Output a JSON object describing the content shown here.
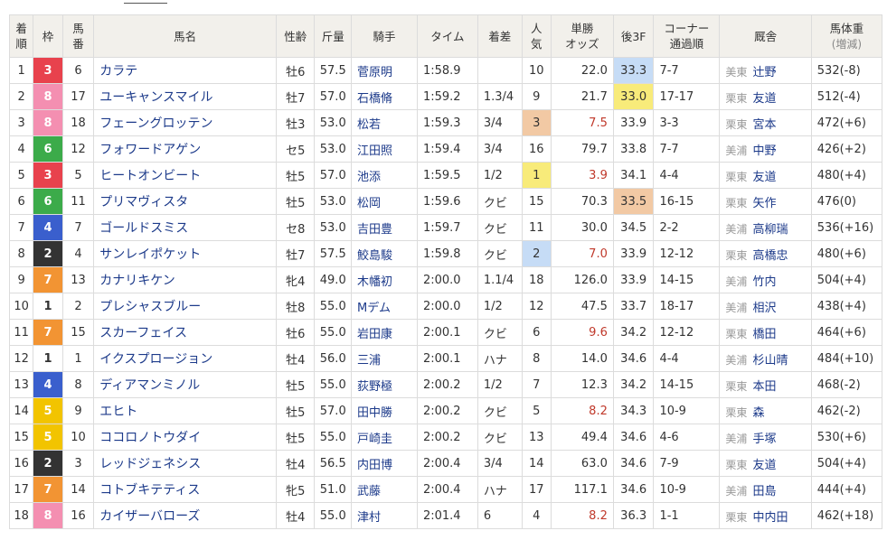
{
  "headers": {
    "order": [
      "着",
      "順"
    ],
    "waku": "枠",
    "umaban": [
      "馬",
      "番"
    ],
    "horse": "馬名",
    "sexage": "性齢",
    "weight": "斤量",
    "jockey": "騎手",
    "time": "タイム",
    "margin": "着差",
    "pop": [
      "人",
      "気"
    ],
    "odds": [
      "単勝",
      "オッズ"
    ],
    "last3f": "後3F",
    "corner": [
      "コーナー",
      "通過順"
    ],
    "trainer": "厩舎",
    "body": [
      "馬体重",
      "(増減)"
    ]
  },
  "waku_colors": {
    "1": {
      "bg": "#ffffff",
      "fg": "#333333"
    },
    "2": {
      "bg": "#333333",
      "fg": "#ffffff"
    },
    "3": {
      "bg": "#e8424d",
      "fg": "#ffffff"
    },
    "4": {
      "bg": "#3a5fcd",
      "fg": "#ffffff"
    },
    "5": {
      "bg": "#f2c400",
      "fg": "#ffffff"
    },
    "6": {
      "bg": "#3cab4a",
      "fg": "#ffffff"
    },
    "7": {
      "bg": "#f29433",
      "fg": "#ffffff"
    },
    "8": {
      "bg": "#f48fb1",
      "fg": "#ffffff"
    }
  },
  "rows": [
    {
      "order": "1",
      "waku": "3",
      "umaban": "6",
      "horse": "カラテ",
      "sexage": "牡6",
      "weight": "57.5",
      "jockey": "菅原明",
      "time": "1:58.9",
      "margin": "",
      "pop": "10",
      "odds": "22.0",
      "odds_red": false,
      "last3f": "33.3",
      "l3f_rank": 2,
      "corner": "7-7",
      "area": "美東",
      "trainer": "辻野",
      "body": "532(-8)",
      "pop_rank": 0
    },
    {
      "order": "2",
      "waku": "8",
      "umaban": "17",
      "horse": "ユーキャンスマイル",
      "sexage": "牡7",
      "weight": "57.0",
      "jockey": "石橋脩",
      "time": "1:59.2",
      "margin": "1.3/4",
      "pop": "9",
      "odds": "21.7",
      "odds_red": false,
      "last3f": "33.0",
      "l3f_rank": 1,
      "corner": "17-17",
      "area": "栗東",
      "trainer": "友道",
      "body": "512(-4)",
      "pop_rank": 0
    },
    {
      "order": "3",
      "waku": "8",
      "umaban": "18",
      "horse": "フェーングロッテン",
      "sexage": "牡3",
      "weight": "53.0",
      "jockey": "松若",
      "time": "1:59.3",
      "margin": "3/4",
      "pop": "3",
      "odds": "7.5",
      "odds_red": true,
      "last3f": "33.9",
      "l3f_rank": 0,
      "corner": "3-3",
      "area": "栗東",
      "trainer": "宮本",
      "body": "472(+6)",
      "pop_rank": 3
    },
    {
      "order": "4",
      "waku": "6",
      "umaban": "12",
      "horse": "フォワードアゲン",
      "sexage": "セ5",
      "weight": "53.0",
      "jockey": "江田照",
      "time": "1:59.4",
      "margin": "3/4",
      "pop": "16",
      "odds": "79.7",
      "odds_red": false,
      "last3f": "33.8",
      "l3f_rank": 0,
      "corner": "7-7",
      "area": "美浦",
      "trainer": "中野",
      "body": "426(+2)",
      "pop_rank": 0
    },
    {
      "order": "5",
      "waku": "3",
      "umaban": "5",
      "horse": "ヒートオンビート",
      "sexage": "牡5",
      "weight": "57.0",
      "jockey": "池添",
      "time": "1:59.5",
      "margin": "1/2",
      "pop": "1",
      "odds": "3.9",
      "odds_red": true,
      "last3f": "34.1",
      "l3f_rank": 0,
      "corner": "4-4",
      "area": "栗東",
      "trainer": "友道",
      "body": "480(+4)",
      "pop_rank": 1
    },
    {
      "order": "6",
      "waku": "6",
      "umaban": "11",
      "horse": "プリマヴィスタ",
      "sexage": "牡5",
      "weight": "53.0",
      "jockey": "松岡",
      "time": "1:59.6",
      "margin": "クビ",
      "pop": "15",
      "odds": "70.3",
      "odds_red": false,
      "last3f": "33.5",
      "l3f_rank": 3,
      "corner": "16-15",
      "area": "栗東",
      "trainer": "矢作",
      "body": "476(0)",
      "pop_rank": 0
    },
    {
      "order": "7",
      "waku": "4",
      "umaban": "7",
      "horse": "ゴールドスミス",
      "sexage": "セ8",
      "weight": "53.0",
      "jockey": "吉田豊",
      "time": "1:59.7",
      "margin": "クビ",
      "pop": "11",
      "odds": "30.0",
      "odds_red": false,
      "last3f": "34.5",
      "l3f_rank": 0,
      "corner": "2-2",
      "area": "美浦",
      "trainer": "高柳瑞",
      "body": "536(+16)",
      "pop_rank": 0
    },
    {
      "order": "8",
      "waku": "2",
      "umaban": "4",
      "horse": "サンレイポケット",
      "sexage": "牡7",
      "weight": "57.5",
      "jockey": "鮫島駿",
      "time": "1:59.8",
      "margin": "クビ",
      "pop": "2",
      "odds": "7.0",
      "odds_red": true,
      "last3f": "33.9",
      "l3f_rank": 0,
      "corner": "12-12",
      "area": "栗東",
      "trainer": "高橋忠",
      "body": "480(+6)",
      "pop_rank": 2
    },
    {
      "order": "9",
      "waku": "7",
      "umaban": "13",
      "horse": "カナリキケン",
      "sexage": "牝4",
      "weight": "49.0",
      "jockey": "木幡初",
      "time": "2:00.0",
      "margin": "1.1/4",
      "pop": "18",
      "odds": "126.0",
      "odds_red": false,
      "last3f": "33.9",
      "l3f_rank": 0,
      "corner": "14-15",
      "area": "美浦",
      "trainer": "竹内",
      "body": "504(+4)",
      "pop_rank": 0
    },
    {
      "order": "10",
      "waku": "1",
      "umaban": "2",
      "horse": "プレシャスブルー",
      "sexage": "牡8",
      "weight": "55.0",
      "jockey": "Mデム",
      "time": "2:00.0",
      "margin": "1/2",
      "pop": "12",
      "odds": "47.5",
      "odds_red": false,
      "last3f": "33.7",
      "l3f_rank": 0,
      "corner": "18-17",
      "area": "美浦",
      "trainer": "相沢",
      "body": "438(+4)",
      "pop_rank": 0
    },
    {
      "order": "11",
      "waku": "7",
      "umaban": "15",
      "horse": "スカーフェイス",
      "sexage": "牡6",
      "weight": "55.0",
      "jockey": "岩田康",
      "time": "2:00.1",
      "margin": "クビ",
      "pop": "6",
      "odds": "9.6",
      "odds_red": true,
      "last3f": "34.2",
      "l3f_rank": 0,
      "corner": "12-12",
      "area": "栗東",
      "trainer": "橋田",
      "body": "464(+6)",
      "pop_rank": 0
    },
    {
      "order": "12",
      "waku": "1",
      "umaban": "1",
      "horse": "イクスプロージョン",
      "sexage": "牡4",
      "weight": "56.0",
      "jockey": "三浦",
      "time": "2:00.1",
      "margin": "ハナ",
      "pop": "8",
      "odds": "14.0",
      "odds_red": false,
      "last3f": "34.6",
      "l3f_rank": 0,
      "corner": "4-4",
      "area": "美浦",
      "trainer": "杉山晴",
      "body": "484(+10)",
      "pop_rank": 0
    },
    {
      "order": "13",
      "waku": "4",
      "umaban": "8",
      "horse": "ディアマンミノル",
      "sexage": "牡5",
      "weight": "55.0",
      "jockey": "荻野極",
      "time": "2:00.2",
      "margin": "1/2",
      "pop": "7",
      "odds": "12.3",
      "odds_red": false,
      "last3f": "34.2",
      "l3f_rank": 0,
      "corner": "14-15",
      "area": "栗東",
      "trainer": "本田",
      "body": "468(-2)",
      "pop_rank": 0
    },
    {
      "order": "14",
      "waku": "5",
      "umaban": "9",
      "horse": "エヒト",
      "sexage": "牡5",
      "weight": "57.0",
      "jockey": "田中勝",
      "time": "2:00.2",
      "margin": "クビ",
      "pop": "5",
      "odds": "8.2",
      "odds_red": true,
      "last3f": "34.3",
      "l3f_rank": 0,
      "corner": "10-9",
      "area": "栗東",
      "trainer": "森",
      "body": "462(-2)",
      "pop_rank": 0
    },
    {
      "order": "15",
      "waku": "5",
      "umaban": "10",
      "horse": "ココロノトウダイ",
      "sexage": "牡5",
      "weight": "55.0",
      "jockey": "戸崎圭",
      "time": "2:00.2",
      "margin": "クビ",
      "pop": "13",
      "odds": "49.4",
      "odds_red": false,
      "last3f": "34.6",
      "l3f_rank": 0,
      "corner": "4-6",
      "area": "美浦",
      "trainer": "手塚",
      "body": "530(+6)",
      "pop_rank": 0
    },
    {
      "order": "16",
      "waku": "2",
      "umaban": "3",
      "horse": "レッドジェネシス",
      "sexage": "牡4",
      "weight": "56.5",
      "jockey": "内田博",
      "time": "2:00.4",
      "margin": "3/4",
      "pop": "14",
      "odds": "63.0",
      "odds_red": false,
      "last3f": "34.6",
      "l3f_rank": 0,
      "corner": "7-9",
      "area": "栗東",
      "trainer": "友道",
      "body": "504(+4)",
      "pop_rank": 0
    },
    {
      "order": "17",
      "waku": "7",
      "umaban": "14",
      "horse": "コトブキテティス",
      "sexage": "牝5",
      "weight": "51.0",
      "jockey": "武藤",
      "time": "2:00.4",
      "margin": "ハナ",
      "pop": "17",
      "odds": "117.1",
      "odds_red": false,
      "last3f": "34.6",
      "l3f_rank": 0,
      "corner": "10-9",
      "area": "美浦",
      "trainer": "田島",
      "body": "444(+4)",
      "pop_rank": 0
    },
    {
      "order": "18",
      "waku": "8",
      "umaban": "16",
      "horse": "カイザーバローズ",
      "sexage": "牡4",
      "weight": "55.0",
      "jockey": "津村",
      "time": "2:01.4",
      "margin": "6",
      "pop": "4",
      "odds": "8.2",
      "odds_red": true,
      "last3f": "36.3",
      "l3f_rank": 0,
      "corner": "1-1",
      "area": "栗東",
      "trainer": "中内田",
      "body": "462(+18)",
      "pop_rank": 0
    }
  ]
}
